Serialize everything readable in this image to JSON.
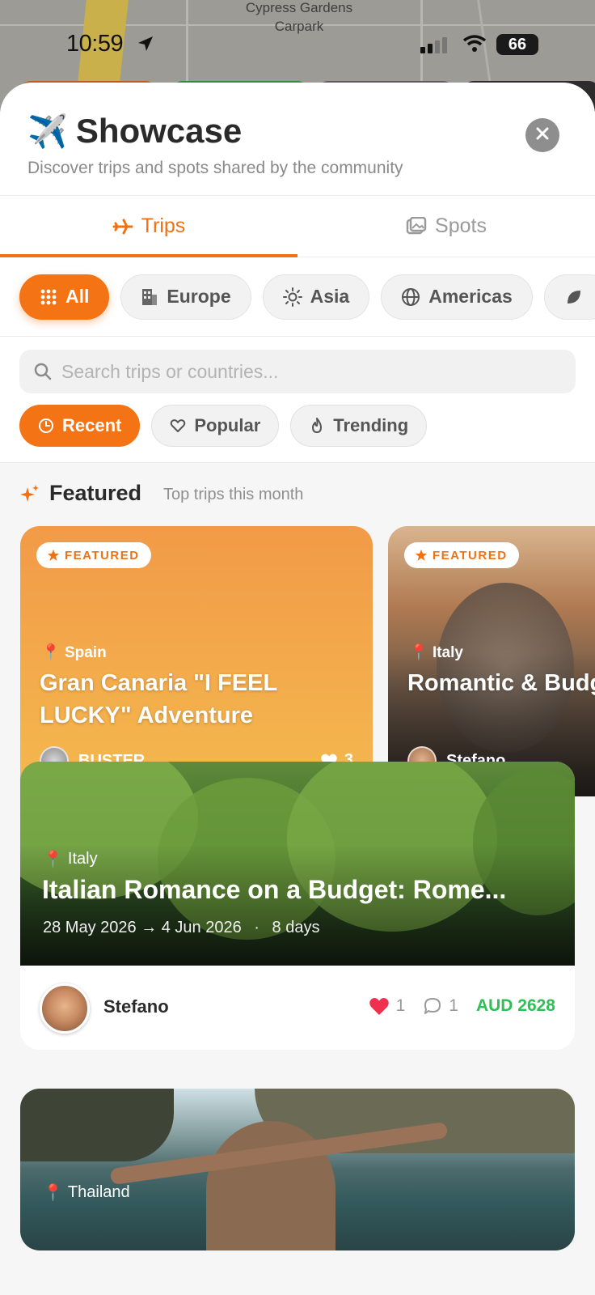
{
  "map": {
    "label_line1": "Cypress Gardens",
    "label_line2": "Carpark"
  },
  "status_bar": {
    "time": "10:59",
    "battery": "66"
  },
  "header": {
    "emoji": "✈️",
    "title": "Showcase",
    "subtitle": "Discover trips and spots shared by the community"
  },
  "tabs": [
    {
      "label": "Trips",
      "active": true,
      "icon": "plane-icon"
    },
    {
      "label": "Spots",
      "active": false,
      "icon": "photos-icon"
    }
  ],
  "regions": [
    {
      "label": "All",
      "active": true,
      "icon": "grid-icon"
    },
    {
      "label": "Europe",
      "active": false,
      "icon": "building-icon"
    },
    {
      "label": "Asia",
      "active": false,
      "icon": "sun-icon"
    },
    {
      "label": "Americas",
      "active": false,
      "icon": "globe-icon"
    }
  ],
  "search": {
    "placeholder": "Search trips or countries..."
  },
  "sorts": [
    {
      "label": "Recent",
      "active": true,
      "icon": "clock-icon"
    },
    {
      "label": "Popular",
      "active": false,
      "icon": "heart-outline-icon"
    },
    {
      "label": "Trending",
      "active": false,
      "icon": "flame-icon"
    }
  ],
  "featured": {
    "title": "Featured",
    "subtitle": "Top trips this month",
    "badge": "FEATURED",
    "cards": [
      {
        "country": "Spain",
        "title": "Gran Canaria \"I FEEL LUCKY\" Adventure",
        "user": "BUSTER",
        "likes": "3"
      },
      {
        "country": "Italy",
        "title": "Romantic & Budget Escape to La Ma",
        "user": "Stefano"
      }
    ]
  },
  "trips": [
    {
      "country": "Italy",
      "title": "Italian Romance on a Budget: Rome...",
      "dates": "28 May 2026 → 4 Jun 2026",
      "separator": "·",
      "duration": "8 days",
      "user": "Stefano",
      "likes": "1",
      "comments": "1",
      "price": "AUD 2628"
    },
    {
      "country": "Thailand"
    }
  ],
  "colors": {
    "accent": "#f47314",
    "price": "#2fbf56",
    "like": "#f0304f"
  }
}
